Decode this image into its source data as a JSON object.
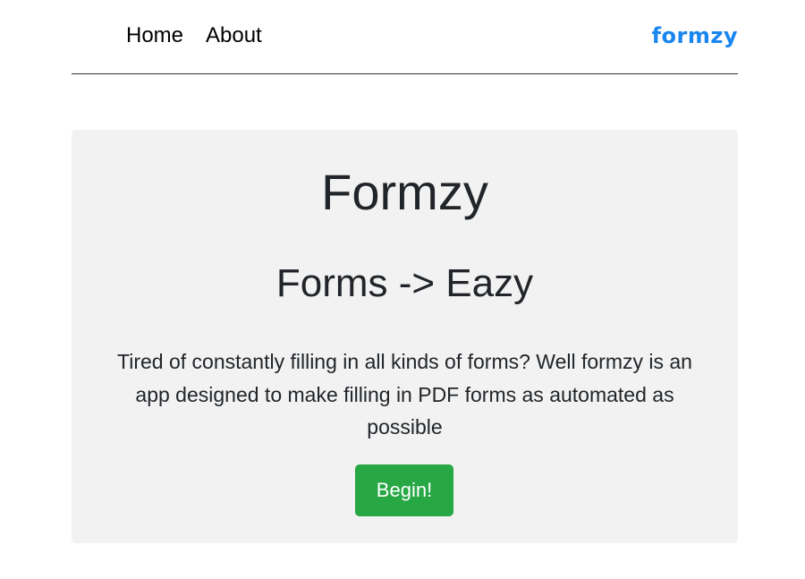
{
  "nav": {
    "items": [
      {
        "label": "Home"
      },
      {
        "label": "About"
      }
    ],
    "brand": "formzy"
  },
  "hero": {
    "title": "Formzy",
    "subtitle": "Forms -> Eazy",
    "description": "Tired of constantly filling in all kinds of forms? Well formzy is an app designed to make filling in PDF forms as automated as possible",
    "button_label": "Begin!"
  },
  "colors": {
    "brand": "#1a86f0",
    "button": "#28a745",
    "jumbotron_bg": "#f2f2f2"
  }
}
